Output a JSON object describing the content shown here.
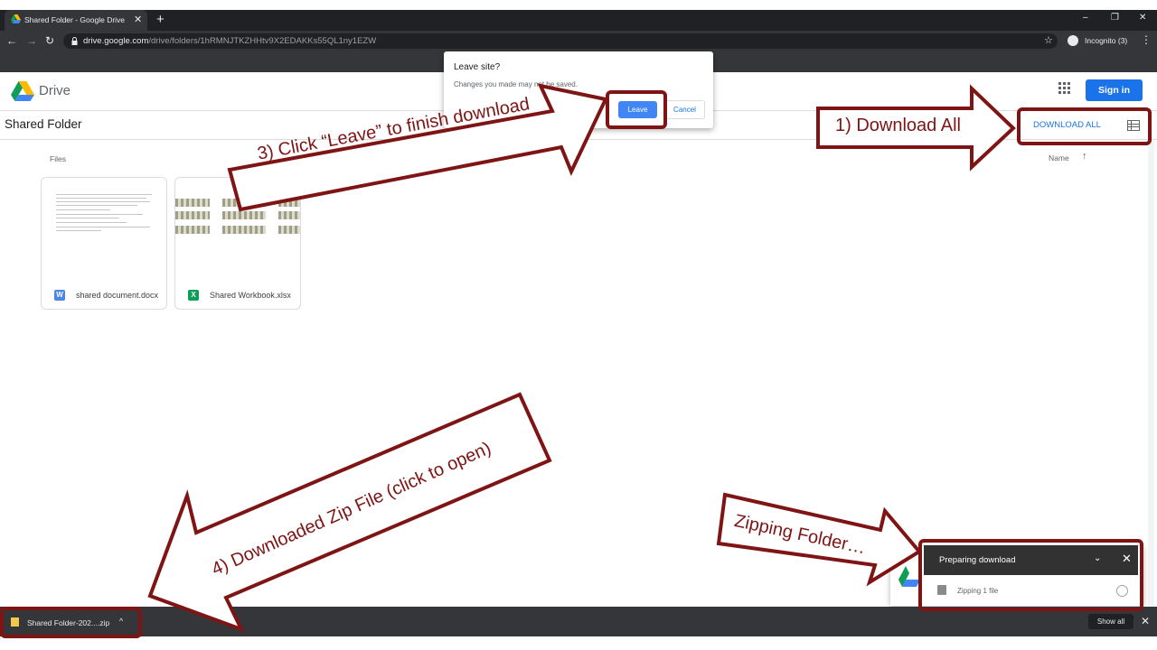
{
  "browser": {
    "tab_title": "Shared Folder - Google Drive",
    "tab_close": "✕",
    "new_tab": "+",
    "url_host": "drive.google.com",
    "url_path": "/drive/folders/1hRMNJTKZHHtv9X2EDAKKs55QL1ny1EZW",
    "incognito_label": "Incognito (3)",
    "window_controls": [
      "–",
      "❐",
      "✕"
    ]
  },
  "drive": {
    "app_name": "Drive",
    "sign_in": "Sign in",
    "folder_title": "Shared Folder",
    "download_all": "DOWNLOAD ALL",
    "files_label": "Files",
    "sort_label": "Name",
    "sort_arrow": "↑",
    "files": [
      {
        "name": "shared document.docx",
        "icon": "W",
        "type": "word-icon",
        "color": "#4a86e8"
      },
      {
        "name": "Shared Workbook.xlsx",
        "icon": "X",
        "type": "excel-icon",
        "color": "#0f9d58"
      }
    ]
  },
  "dialog": {
    "title": "Leave site?",
    "body": "Changes you made may not be saved.",
    "leave": "Leave",
    "cancel": "Cancel"
  },
  "download_panel": {
    "title": "Preparing download",
    "chevron": "⌄",
    "close": "✕",
    "subtitle": "Zipping 1 file"
  },
  "shelf": {
    "filename": "Shared Folder-202....zip",
    "caret": "^",
    "show_all": "Show all",
    "close": "✕"
  },
  "annotations": {
    "step1": "1) Download All",
    "step3": "3) Click “Leave” to finish download",
    "step4": "4) Downloaded Zip File (click to open)",
    "zipping": "Zipping Folder…",
    "color": "#7f1414"
  }
}
